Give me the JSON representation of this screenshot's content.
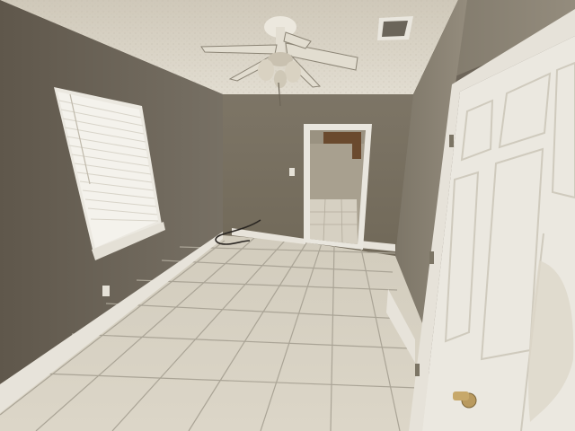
{
  "scene": {
    "description_type": "photo",
    "objects": [
      "ceiling-fan",
      "window-blinds",
      "doorway",
      "closet-door",
      "tile-floor",
      "air-vent",
      "power-cord"
    ]
  },
  "colors": {
    "ceiling": "#d9d3c6",
    "wall_left": "#6e6558",
    "wall_back": "#7a7162",
    "wall_right": "#8a8273",
    "floor": "#d8d2c4",
    "grout": "#a8a294",
    "trim": "#e9e6de",
    "door": "#ece9e1",
    "window_light": "#f3f1ea"
  }
}
